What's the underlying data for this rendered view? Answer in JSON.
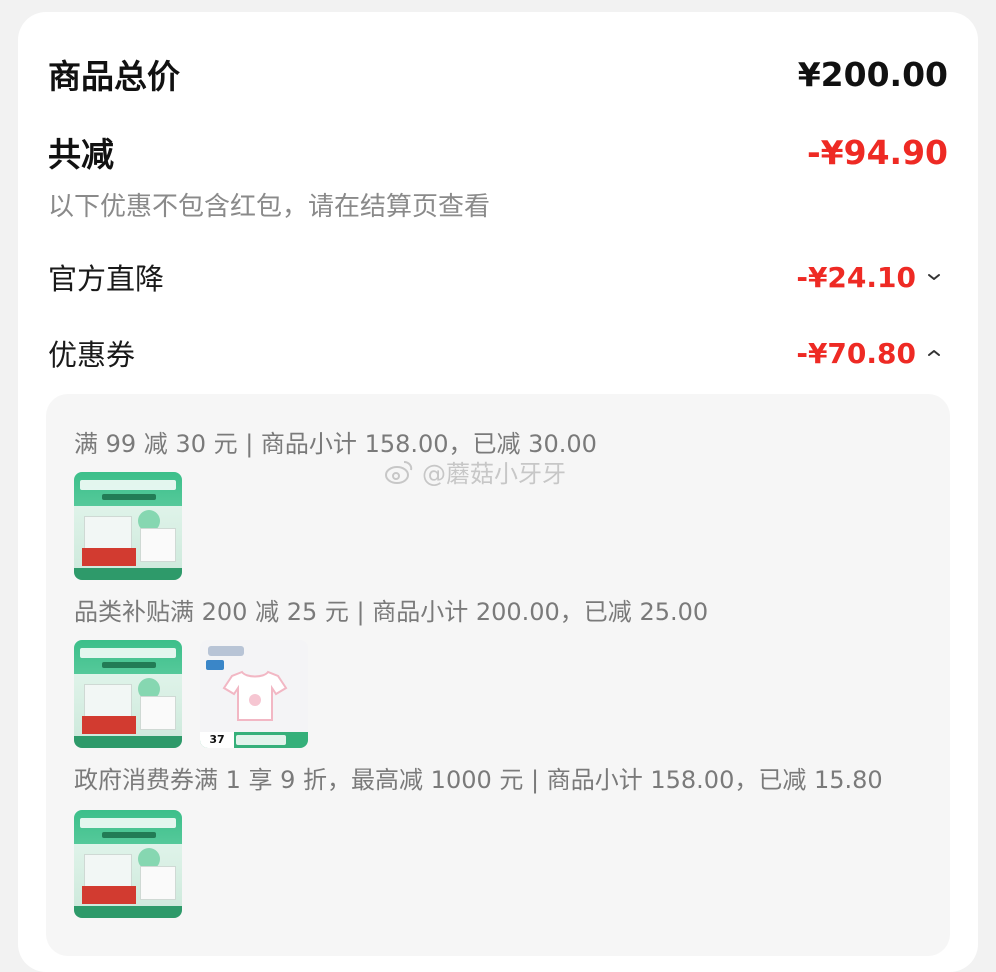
{
  "summary": {
    "total_label": "商品总价",
    "total_value": "¥200.00",
    "reduce_label": "共减",
    "reduce_value": "-¥94.90",
    "note": "以下优惠不包含红包，请在结算页查看"
  },
  "items": [
    {
      "label": "官方直降",
      "value": "-¥24.10",
      "chevron": "chevron-down-icon"
    },
    {
      "label": "优惠券",
      "value": "-¥70.80",
      "chevron": "chevron-up-icon"
    }
  ],
  "promotions": [
    {
      "text": "满 99 减 30 元 | 商品小计 158.00，已减 30.00"
    },
    {
      "text": "品类补贴满 200 减 25 元 | 商品小计 200.00，已减 25.00",
      "shirt_price": "37"
    },
    {
      "text": "政府消费券满 1 享 9 折，最高减 1000 元 | 商品小计 158.00，已减 15.80"
    }
  ],
  "watermark": "@蘑菇小牙牙",
  "colors": {
    "accent_red": "#ee2a24",
    "muted": "#8a8a8a",
    "panel": "#f6f6f6"
  }
}
